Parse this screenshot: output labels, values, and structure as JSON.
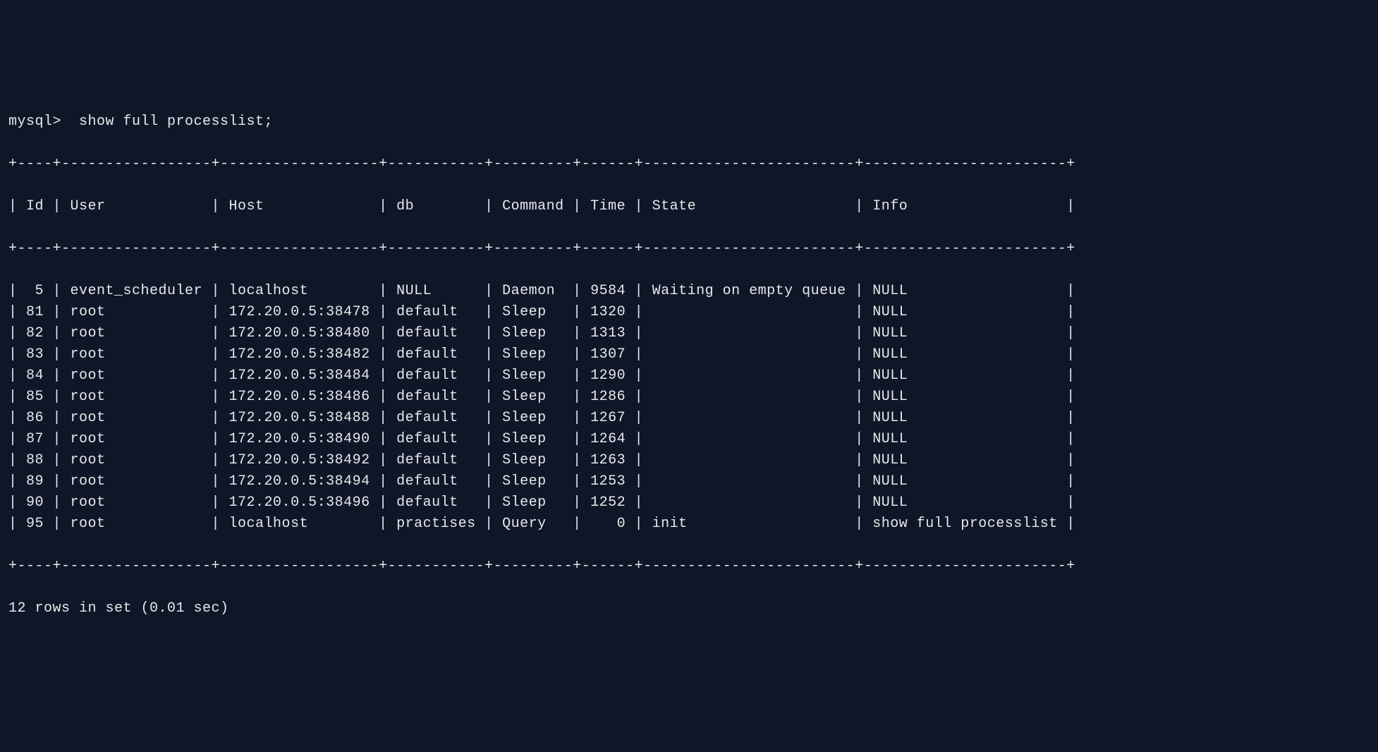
{
  "prompt": "mysql>  show full processlist;",
  "border_top": "+----+-----------------+------------------+-----------+---------+------+------------------------+-----------------------+",
  "header_line": "| Id | User            | Host             | db        | Command | Time | State                  | Info                  |",
  "border_mid": "+----+-----------------+------------------+-----------+---------+------+------------------------+-----------------------+",
  "columns": [
    "Id",
    "User",
    "Host",
    "db",
    "Command",
    "Time",
    "State",
    "Info"
  ],
  "rows": [
    {
      "Id": "5",
      "User": "event_scheduler",
      "Host": "localhost",
      "db": "NULL",
      "Command": "Daemon",
      "Time": "9584",
      "State": "Waiting on empty queue",
      "Info": "NULL"
    },
    {
      "Id": "81",
      "User": "root",
      "Host": "172.20.0.5:38478",
      "db": "default",
      "Command": "Sleep",
      "Time": "1320",
      "State": "",
      "Info": "NULL"
    },
    {
      "Id": "82",
      "User": "root",
      "Host": "172.20.0.5:38480",
      "db": "default",
      "Command": "Sleep",
      "Time": "1313",
      "State": "",
      "Info": "NULL"
    },
    {
      "Id": "83",
      "User": "root",
      "Host": "172.20.0.5:38482",
      "db": "default",
      "Command": "Sleep",
      "Time": "1307",
      "State": "",
      "Info": "NULL"
    },
    {
      "Id": "84",
      "User": "root",
      "Host": "172.20.0.5:38484",
      "db": "default",
      "Command": "Sleep",
      "Time": "1290",
      "State": "",
      "Info": "NULL"
    },
    {
      "Id": "85",
      "User": "root",
      "Host": "172.20.0.5:38486",
      "db": "default",
      "Command": "Sleep",
      "Time": "1286",
      "State": "",
      "Info": "NULL"
    },
    {
      "Id": "86",
      "User": "root",
      "Host": "172.20.0.5:38488",
      "db": "default",
      "Command": "Sleep",
      "Time": "1267",
      "State": "",
      "Info": "NULL"
    },
    {
      "Id": "87",
      "User": "root",
      "Host": "172.20.0.5:38490",
      "db": "default",
      "Command": "Sleep",
      "Time": "1264",
      "State": "",
      "Info": "NULL"
    },
    {
      "Id": "88",
      "User": "root",
      "Host": "172.20.0.5:38492",
      "db": "default",
      "Command": "Sleep",
      "Time": "1263",
      "State": "",
      "Info": "NULL"
    },
    {
      "Id": "89",
      "User": "root",
      "Host": "172.20.0.5:38494",
      "db": "default",
      "Command": "Sleep",
      "Time": "1253",
      "State": "",
      "Info": "NULL"
    },
    {
      "Id": "90",
      "User": "root",
      "Host": "172.20.0.5:38496",
      "db": "default",
      "Command": "Sleep",
      "Time": "1252",
      "State": "",
      "Info": "NULL"
    },
    {
      "Id": "95",
      "User": "root",
      "Host": "localhost",
      "db": "practises",
      "Command": "Query",
      "Time": "0",
      "State": "init",
      "Info": "show full processlist"
    }
  ],
  "border_bot": "+----+-----------------+------------------+-----------+---------+------+------------------------+-----------------------+",
  "footer": "12 rows in set (0.01 sec)",
  "col_widths": {
    "Id": 2,
    "User": 15,
    "Host": 16,
    "db": 9,
    "Command": 7,
    "Time": 4,
    "State": 22,
    "Info": 21
  },
  "col_align": {
    "Id": "right",
    "User": "left",
    "Host": "left",
    "db": "left",
    "Command": "left",
    "Time": "right",
    "State": "left",
    "Info": "left"
  }
}
